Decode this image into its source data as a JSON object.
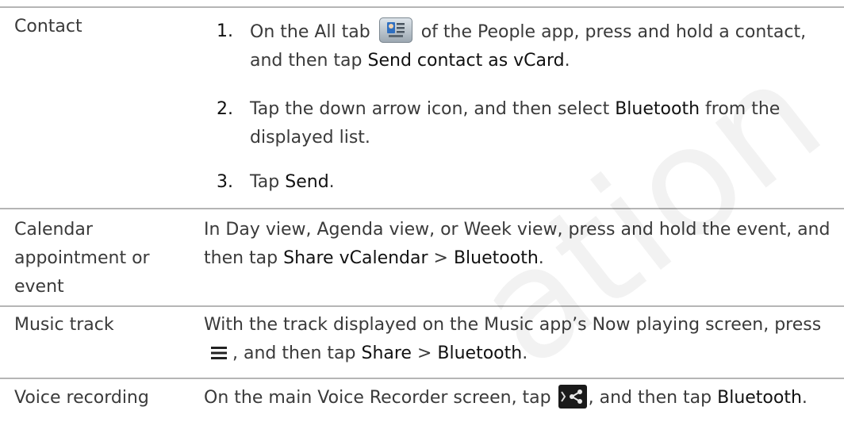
{
  "rows": [
    {
      "label": "Contact",
      "steps": [
        {
          "num": "1.",
          "t1": "On the All tab",
          "t2": " of the People app, press and hold a contact, and then tap ",
          "em1": "Send contact as vCard",
          "t3": "."
        },
        {
          "num": "2.",
          "t1": "Tap the down arrow icon, and then select ",
          "em1": "Bluetooth",
          "t2": " from the displayed list."
        },
        {
          "num": "3.",
          "t1": "Tap ",
          "em1": "Send",
          "t2": "."
        }
      ]
    },
    {
      "label_lines": [
        "Calendar",
        "appointment or",
        "event"
      ],
      "t1": "In Day view, Agenda view, or Week view, press and hold the event, and then tap ",
      "em1": "Share vCalendar",
      "t2": " > ",
      "em2": "Bluetooth",
      "t3": "."
    },
    {
      "label": "Music track",
      "t1": "With the track displayed on the Music app’s Now playing screen, press ",
      "t2": ", and then tap ",
      "em1": "Share",
      "t3": " > ",
      "em2": "Bluetooth",
      "t4": "."
    },
    {
      "label": "Voice recording",
      "t1": "On the main Voice Recorder screen, tap ",
      "t2": ", and then tap ",
      "em1": "Bluetooth",
      "t3": "."
    }
  ],
  "icons": {
    "people_tab": "people-all-tab-icon",
    "menu": "menu-icon",
    "share": "share-icon"
  },
  "colors": {
    "text": "#3a3a3a",
    "emphasis": "#111111",
    "rule": "#b5b5b5"
  }
}
